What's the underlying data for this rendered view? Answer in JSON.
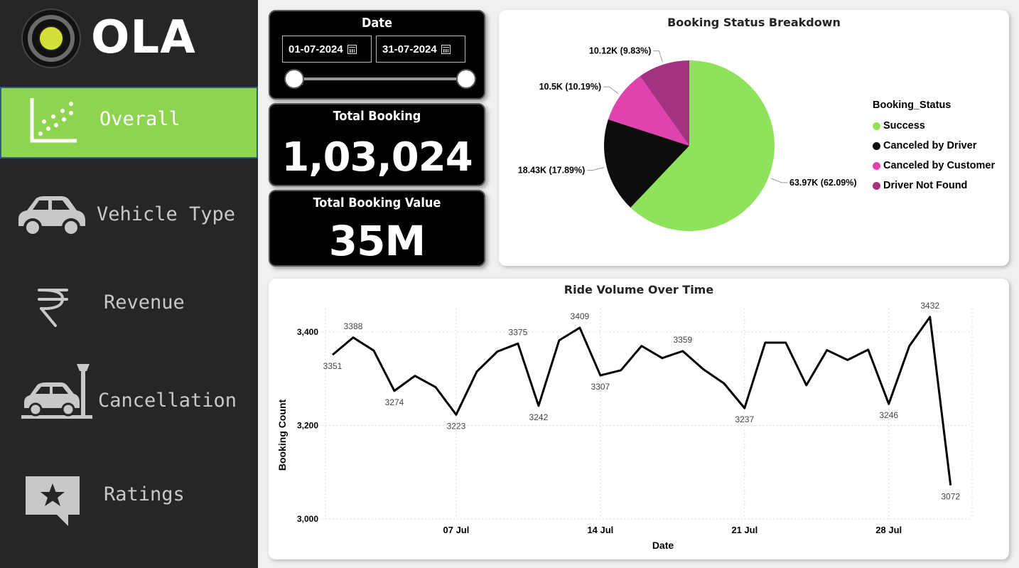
{
  "nav": [
    {
      "label": "Overall",
      "icon": "scatter-chart-icon",
      "active": true
    },
    {
      "label": "Vehicle Type",
      "icon": "car-icon",
      "active": false
    },
    {
      "label": "Revenue",
      "icon": "rupee-icon",
      "active": false
    },
    {
      "label": "Cancellation",
      "icon": "car-crash-icon",
      "active": false
    },
    {
      "label": "Ratings",
      "icon": "star-comment-icon",
      "active": false
    }
  ],
  "logo": {
    "text": "OLA"
  },
  "date_filter": {
    "title": "Date",
    "start": "01-07-2024",
    "end": "31-07-2024",
    "range_fraction": [
      0,
      1
    ]
  },
  "kpis": {
    "total_booking": {
      "title": "Total Booking",
      "value": "1,03,024"
    },
    "total_booking_value": {
      "title": "Total Booking Value",
      "value": "35M"
    }
  },
  "colors": {
    "success": "#8fe35c",
    "canceled_driver": "#0d0d0d",
    "canceled_customer": "#e043ad",
    "not_found": "#a43282",
    "active_nav": "#8fd451"
  },
  "pie_panel": {
    "title": "Booking Status Breakdown",
    "legend_title": "Booking_Status"
  },
  "line_panel": {
    "title": "Ride Volume Over Time"
  },
  "chart_data": [
    {
      "type": "pie",
      "title": "Booking Status Breakdown",
      "legend_title": "Booking_Status",
      "legend_position": "right",
      "slices": [
        {
          "label": "Success",
          "value": 63970,
          "percent": 62.09,
          "data_label": "63.97K (62.09%)",
          "color": "#8fe35c"
        },
        {
          "label": "Canceled by Driver",
          "value": 18430,
          "percent": 17.89,
          "data_label": "18.43K (17.89%)",
          "color": "#0d0d0d"
        },
        {
          "label": "Canceled by Customer",
          "value": 10500,
          "percent": 10.19,
          "data_label": "10.5K (10.19%)",
          "color": "#e043ad"
        },
        {
          "label": "Driver Not Found",
          "value": 10120,
          "percent": 9.83,
          "data_label": "10.12K (9.83%)",
          "color": "#a43282"
        }
      ]
    },
    {
      "type": "line",
      "title": "Ride Volume Over Time",
      "xlabel": "Date",
      "ylabel": "Booking Count",
      "ylim": [
        3000,
        3450
      ],
      "yticks": [
        3000,
        3200,
        3400
      ],
      "ytick_labels": [
        "3,000",
        "3,200",
        "3,400"
      ],
      "xtick_labels": [
        {
          "day": 7,
          "label": "07 Jul"
        },
        {
          "day": 14,
          "label": "14 Jul"
        },
        {
          "day": 21,
          "label": "21 Jul"
        },
        {
          "day": 28,
          "label": "28 Jul"
        }
      ],
      "grid": true,
      "x": [
        "2024-07-01",
        "2024-07-02",
        "2024-07-03",
        "2024-07-04",
        "2024-07-05",
        "2024-07-06",
        "2024-07-07",
        "2024-07-08",
        "2024-07-09",
        "2024-07-10",
        "2024-07-11",
        "2024-07-12",
        "2024-07-13",
        "2024-07-14",
        "2024-07-15",
        "2024-07-16",
        "2024-07-17",
        "2024-07-18",
        "2024-07-19",
        "2024-07-20",
        "2024-07-21",
        "2024-07-22",
        "2024-07-23",
        "2024-07-24",
        "2024-07-25",
        "2024-07-26",
        "2024-07-27",
        "2024-07-28",
        "2024-07-29",
        "2024-07-30",
        "2024-07-31"
      ],
      "values": [
        3351,
        3388,
        3360,
        3274,
        3306,
        3282,
        3223,
        3315,
        3358,
        3375,
        3242,
        3382,
        3409,
        3307,
        3318,
        3370,
        3344,
        3359,
        3320,
        3290,
        3237,
        3377,
        3377,
        3286,
        3361,
        3340,
        3362,
        3246,
        3370,
        3432,
        3072
      ],
      "labeled_points": [
        1,
        2,
        4,
        7,
        10,
        11,
        13,
        14,
        18,
        21,
        28,
        30,
        31
      ],
      "label_above": [
        2,
        10,
        13,
        18,
        30
      ]
    }
  ]
}
